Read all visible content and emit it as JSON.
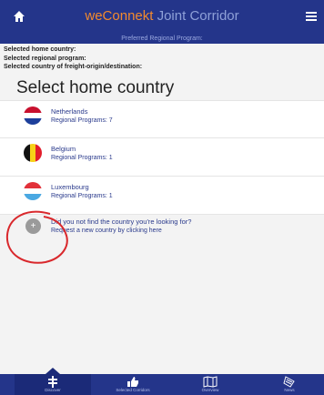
{
  "header": {
    "brand": "weConnekt",
    "title_rest": " Joint Corridor",
    "subtitle": "Preferred Regional Program:",
    "home_icon": "home-icon",
    "menu_icon": "hamburger-menu-icon"
  },
  "selection": {
    "home_country": "Selected home country:",
    "regional_program": "Selected regional program:",
    "freight_country": "Selected country of freight-origin/destination:"
  },
  "page_title": "Select home country",
  "countries": [
    {
      "name": "Netherlands",
      "programs": "Regional Programs: 7",
      "flag": "netherlands-flag"
    },
    {
      "name": "Belgium",
      "programs": "Regional Programs: 1",
      "flag": "belgium-flag"
    },
    {
      "name": "Luxembourg",
      "programs": "Regional Programs: 1",
      "flag": "luxembourg-flag"
    }
  ],
  "add_country": {
    "icon": "+",
    "title": "Did you not find the country you're looking for?",
    "subtitle": "Request a new country by clicking here"
  },
  "nav": {
    "active": "Discover",
    "tabs": [
      {
        "label": "Discover",
        "icon": "signpost-icon"
      },
      {
        "label": "Selected Corridors",
        "icon": "thumbs-up-icon"
      },
      {
        "label": "Overview",
        "icon": "map-icon"
      },
      {
        "label": "News",
        "icon": "newspaper-icon"
      }
    ]
  },
  "colors": {
    "header_bg": "#24358a",
    "brand_orange": "#f28a2e",
    "link_blue": "#2a3a8c",
    "annotation_red": "#d9282c"
  }
}
